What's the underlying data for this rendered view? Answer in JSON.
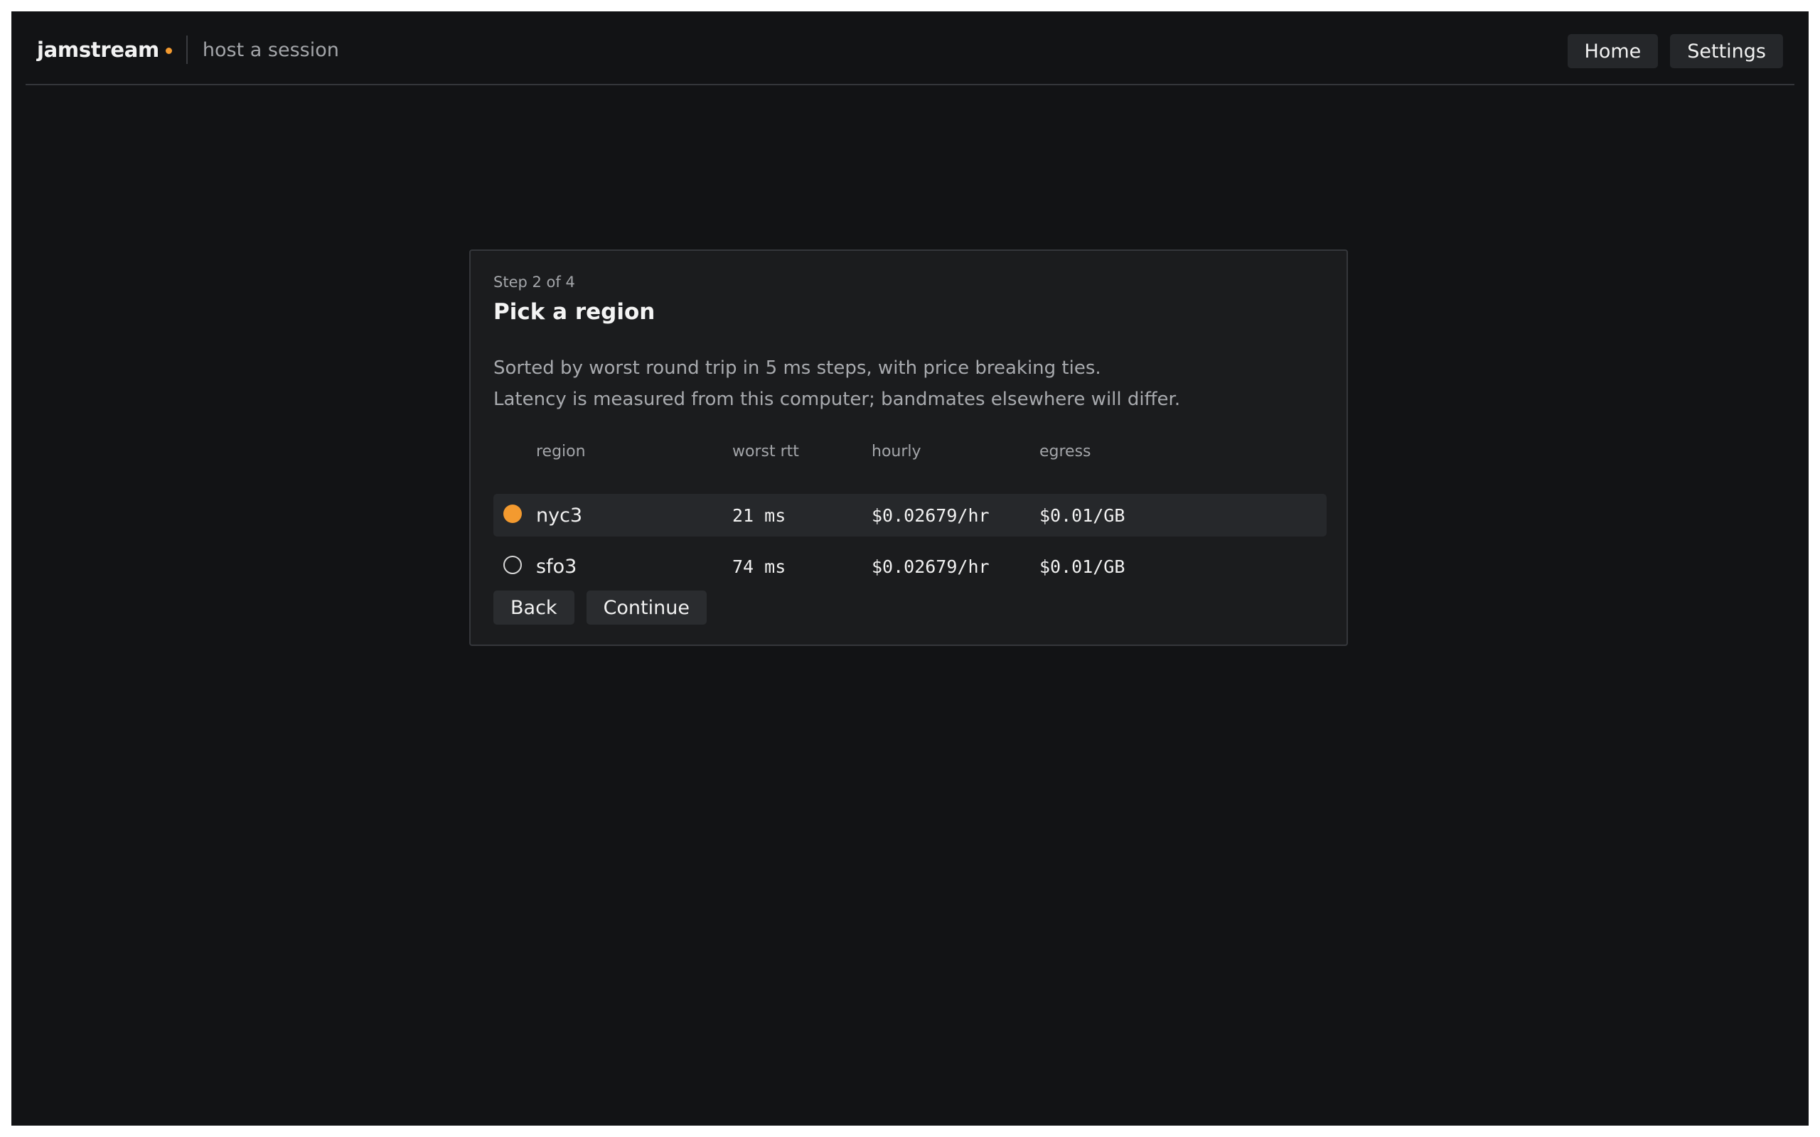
{
  "app": {
    "name": "jamstream",
    "subtitle": "host a session"
  },
  "nav": {
    "home_label": "Home",
    "settings_label": "Settings"
  },
  "wizard": {
    "step": "Step 2 of 4",
    "title": "Pick a region",
    "description_line1": "Sorted by worst round trip in 5 ms steps, with price breaking ties.",
    "description_line2": "Latency is measured from this computer; bandmates elsewhere will differ.",
    "columns": {
      "region": "region",
      "rtt": "worst rtt",
      "hourly": "hourly",
      "egress": "egress"
    },
    "rows": [
      {
        "region": "nyc3",
        "rtt": "21 ms",
        "hourly": "$0.02679/hr",
        "egress": "$0.01/GB",
        "selected": true
      },
      {
        "region": "sfo3",
        "rtt": "74 ms",
        "hourly": "$0.02679/hr",
        "egress": "$0.01/GB",
        "selected": false
      }
    ],
    "back_label": "Back",
    "continue_label": "Continue"
  },
  "colors": {
    "accent": "#f39a2f",
    "background": "#121315",
    "card": "#1b1c1e"
  }
}
